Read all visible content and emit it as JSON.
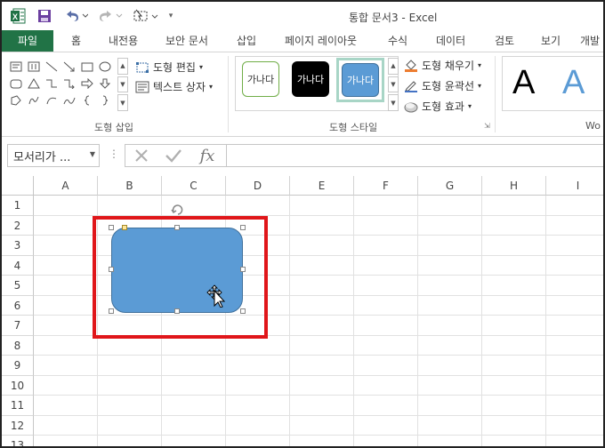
{
  "window": {
    "title": "통합 문서3 - Excel"
  },
  "quick_access": {
    "save": "save-icon",
    "undo": "undo-icon",
    "redo": "redo-icon",
    "select": "select-objects-icon",
    "customize": "customize-icon"
  },
  "tabs": [
    {
      "label": "파일",
      "active": false
    },
    {
      "label": "홈"
    },
    {
      "label": "내전용"
    },
    {
      "label": "보안 문서"
    },
    {
      "label": "삽입"
    },
    {
      "label": "페이지 레이아웃"
    },
    {
      "label": "수식"
    },
    {
      "label": "데이터"
    },
    {
      "label": "검토"
    },
    {
      "label": "보기"
    },
    {
      "label": "개발"
    }
  ],
  "ribbon": {
    "insert_shapes": {
      "label": "도형 삽입",
      "edit_shape": "도형 편집",
      "text_box": "텍스트 상자"
    },
    "shape_styles": {
      "label": "도형 스타일",
      "samples": [
        "가나다",
        "가나다",
        "가나다"
      ],
      "fill": "도형 채우기",
      "outline": "도형 윤곽선",
      "effects": "도형 효과"
    },
    "wordart": {
      "label": "Wo",
      "sample": "A"
    }
  },
  "formula_bar": {
    "name_box": "모서리가 ...",
    "fx": "fx",
    "value": ""
  },
  "sheet": {
    "columns": [
      "A",
      "B",
      "C",
      "D",
      "E",
      "F",
      "G",
      "H",
      "I"
    ],
    "rows": [
      "1",
      "2",
      "3",
      "4",
      "5",
      "6",
      "7",
      "8",
      "9",
      "10",
      "11",
      "12",
      "13"
    ],
    "shape": {
      "type": "rounded-rectangle",
      "fill": "#5b9bd5",
      "selected": true
    },
    "highlight_color": "#e0161a"
  },
  "colors": {
    "file_tab": "#217346",
    "shape_fill": "#5b9bd5",
    "accent_red": "#e0161a"
  }
}
